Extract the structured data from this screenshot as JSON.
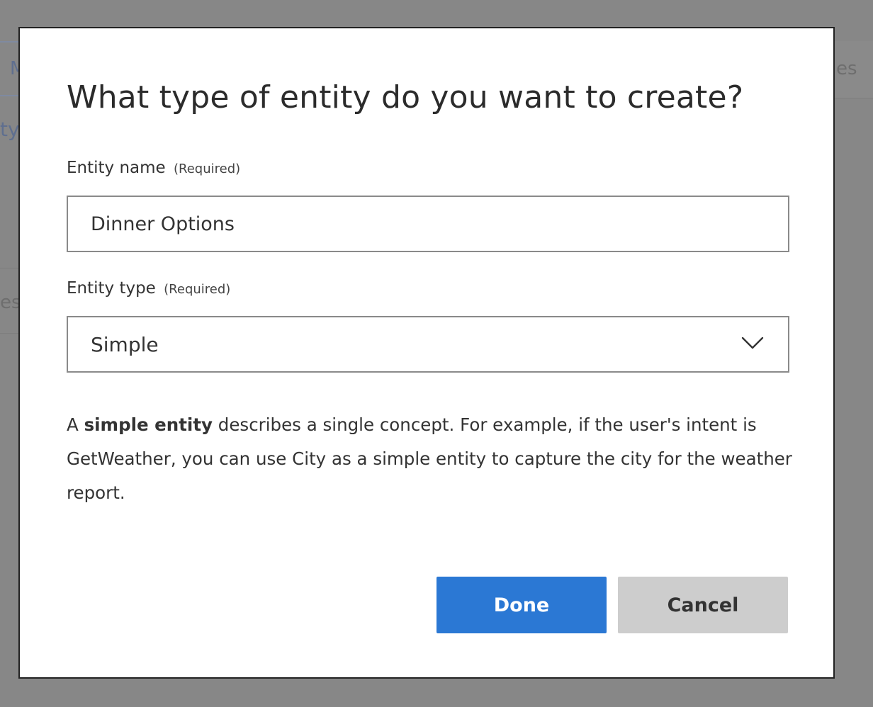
{
  "dialog": {
    "title": "What type of entity do you want to create?",
    "name_field": {
      "label": "Entity name",
      "required": "(Required)",
      "value": "Dinner Options"
    },
    "type_field": {
      "label": "Entity type",
      "required": "(Required)",
      "selected": "Simple",
      "icon": "chevron-down-icon"
    },
    "description": {
      "prefix": "A ",
      "emphasis": "simple entity",
      "rest": " describes a single concept. For example, if the user's intent is GetWeather, you can use City as a simple entity to capture the city for the weather report."
    },
    "buttons": {
      "done": "Done",
      "cancel": "Cancel"
    }
  },
  "background": {
    "fragment_left_1": "M",
    "fragment_left_2": "ty",
    "fragment_left_3": "es",
    "fragment_right": "es"
  },
  "colors": {
    "overlay": "#878787",
    "primary": "#2b78d4",
    "secondary": "#cdcdcd",
    "text": "#333333"
  }
}
